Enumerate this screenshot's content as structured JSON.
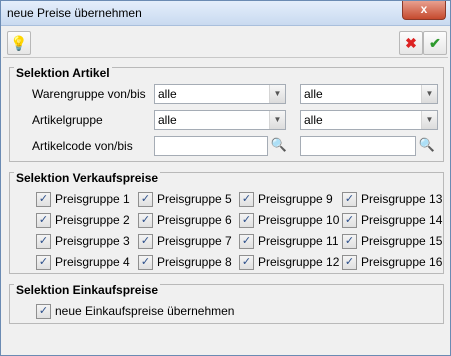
{
  "window": {
    "title": "neue Preise übernehmen",
    "close_label": "x"
  },
  "toolbar": {
    "tip_icon": "lightbulb-icon",
    "cancel_icon": "red-x-icon",
    "ok_icon": "green-check-icon"
  },
  "artikel": {
    "title": "Selektion Artikel",
    "warengruppe_label": "Warengruppe von/bis",
    "warengruppe_von": "alle",
    "warengruppe_bis": "alle",
    "artikelgruppe_label": "Artikelgruppe",
    "artikelgruppe_von": "alle",
    "artikelgruppe_bis": "alle",
    "artikelcode_label": "Artikelcode von/bis",
    "artikelcode_von": "",
    "artikelcode_bis": ""
  },
  "verkaufspreise": {
    "title": "Selektion Verkaufspreise",
    "items": [
      {
        "label": "Preisgruppe 1",
        "checked": true
      },
      {
        "label": "Preisgruppe 2",
        "checked": true
      },
      {
        "label": "Preisgruppe 3",
        "checked": true
      },
      {
        "label": "Preisgruppe 4",
        "checked": true
      },
      {
        "label": "Preisgruppe 5",
        "checked": true
      },
      {
        "label": "Preisgruppe 6",
        "checked": true
      },
      {
        "label": "Preisgruppe 7",
        "checked": true
      },
      {
        "label": "Preisgruppe 8",
        "checked": true
      },
      {
        "label": "Preisgruppe 9",
        "checked": true
      },
      {
        "label": "Preisgruppe 10",
        "checked": true
      },
      {
        "label": "Preisgruppe 11",
        "checked": true
      },
      {
        "label": "Preisgruppe 12",
        "checked": true
      },
      {
        "label": "Preisgruppe 13",
        "checked": true
      },
      {
        "label": "Preisgruppe 14",
        "checked": true
      },
      {
        "label": "Preisgruppe 15",
        "checked": true
      },
      {
        "label": "Preisgruppe 16",
        "checked": true
      }
    ]
  },
  "einkaufspreise": {
    "title": "Selektion Einkaufspreise",
    "option_label": "neue Einkaufspreise übernehmen",
    "option_checked": true
  },
  "colors": {
    "titlebar": "#c9daf0",
    "close": "#c54a2e",
    "check": "#2c4f8a"
  }
}
